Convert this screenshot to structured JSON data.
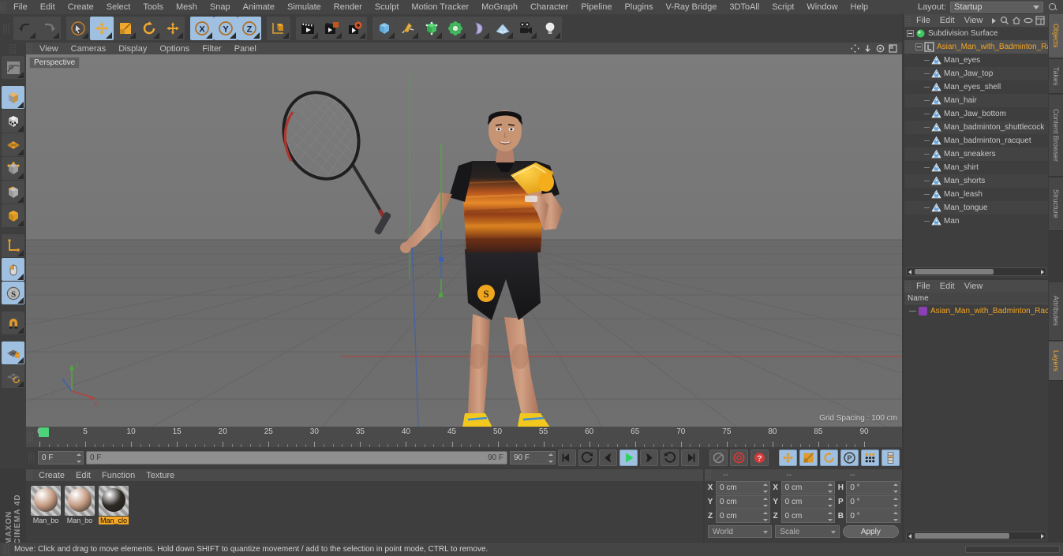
{
  "app": {
    "brand": "MAXON CINEMA 4D"
  },
  "menubar": {
    "items": [
      "File",
      "Edit",
      "Create",
      "Select",
      "Tools",
      "Mesh",
      "Snap",
      "Animate",
      "Simulate",
      "Render",
      "Sculpt",
      "Motion Tracker",
      "MoGraph",
      "Character",
      "Pipeline",
      "Plugins",
      "V-Ray Bridge",
      "3DToAll",
      "Script",
      "Window",
      "Help"
    ],
    "layout_label": "Layout:",
    "layout_value": "Startup",
    "search_icon": "search-icon"
  },
  "toolbar": {
    "buttons": [
      {
        "name": "undo-button",
        "icon": "undo-icon",
        "active": false
      },
      {
        "name": "redo-button",
        "icon": "redo-icon",
        "active": false
      },
      {
        "name": "live-selection-button",
        "icon": "cursor-select-icon",
        "active": false
      },
      {
        "name": "move-tool-button",
        "icon": "move-arrows-icon",
        "active": true
      },
      {
        "name": "scale-tool-button",
        "icon": "scale-box-icon",
        "active": false
      },
      {
        "name": "rotate-tool-button",
        "icon": "rotate-circle-icon",
        "active": false
      },
      {
        "name": "move-axis-button",
        "icon": "move-plus-icon",
        "active": false
      },
      {
        "name": "lock-x-axis-button",
        "icon": "axis-x-icon",
        "active": true
      },
      {
        "name": "lock-y-axis-button",
        "icon": "axis-y-icon",
        "active": true
      },
      {
        "name": "lock-z-axis-button",
        "icon": "axis-z-icon",
        "active": true
      },
      {
        "name": "world-coordinate-button",
        "icon": "world-axis-cube-icon",
        "active": false
      },
      {
        "name": "render-view-button",
        "icon": "render-clapper-icon",
        "active": false
      },
      {
        "name": "render-region-button",
        "icon": "render-clapper-region-icon",
        "active": false
      },
      {
        "name": "render-settings-button",
        "icon": "render-gear-icon",
        "active": false
      },
      {
        "name": "primitive-cube-button",
        "icon": "cube-icon",
        "active": false
      },
      {
        "name": "spline-pen-button",
        "icon": "pen-spline-icon",
        "active": false
      },
      {
        "name": "generator-button",
        "icon": "green-cube-icon",
        "active": false
      },
      {
        "name": "mograph-button",
        "icon": "green-cloner-icon",
        "active": false
      },
      {
        "name": "deformer-button",
        "icon": "bend-deformer-icon",
        "active": false
      },
      {
        "name": "environment-button",
        "icon": "floor-grid-icon",
        "active": false
      },
      {
        "name": "camera-button",
        "icon": "camera-icon",
        "active": false
      },
      {
        "name": "light-button",
        "icon": "light-bulb-icon",
        "active": false
      }
    ]
  },
  "leftbar": {
    "buttons": [
      {
        "name": "make-editable-button",
        "icon": "make-editable-icon",
        "active": false
      },
      {
        "name": "model-mode-button",
        "icon": "model-cube-icon",
        "active": true
      },
      {
        "name": "texture-mode-button",
        "icon": "texture-cube-icon",
        "active": false
      },
      {
        "name": "polygon-mode-button",
        "icon": "polygon-grid-icon",
        "active": false
      },
      {
        "name": "point-mode-button",
        "icon": "point-cube-icon",
        "active": false
      },
      {
        "name": "edge-mode-button",
        "icon": "edge-cube-icon",
        "active": false
      },
      {
        "name": "object-axis-button",
        "icon": "orange-cube-icon",
        "active": false
      },
      {
        "name": "axis-modification-button",
        "icon": "axis-l-icon",
        "active": false
      },
      {
        "name": "viewport-solo-button",
        "icon": "mouse-icon",
        "active": true
      },
      {
        "name": "enable-axis-button",
        "icon": "s-circle-icon",
        "active": true
      },
      {
        "name": "magnet-button",
        "icon": "magnet-icon",
        "active": false
      },
      {
        "name": "lock-workplane-button",
        "icon": "grid-lock-icon",
        "active": true
      },
      {
        "name": "workplane-button",
        "icon": "grid-rotate-icon",
        "active": false
      }
    ]
  },
  "viewport": {
    "menu": [
      "View",
      "Cameras",
      "Display",
      "Options",
      "Filter",
      "Panel"
    ],
    "nav_icons": [
      "pan-icon",
      "zoom-icon",
      "rotate-view-icon",
      "maximize-view-icon"
    ],
    "label": "Perspective",
    "grid_spacing": "Grid Spacing : 100 cm",
    "axis_gizmo": {
      "x_label": "X",
      "y_label": "Y",
      "z_label": "Z"
    }
  },
  "timeline": {
    "ticks": [
      0,
      5,
      10,
      15,
      20,
      25,
      30,
      35,
      40,
      45,
      50,
      55,
      60,
      65,
      70,
      75,
      80,
      85,
      90
    ],
    "current_frame": 0,
    "playhead_frame": 0,
    "frame_field": "0 F",
    "range_start": "0 F",
    "range_end": "90 F",
    "preview_end": "90 F",
    "end_field": "90 F",
    "transport": [
      {
        "name": "go-to-start-button",
        "icon": "skip-start-icon"
      },
      {
        "name": "previous-key-button",
        "icon": "prev-key-icon"
      },
      {
        "name": "step-back-button",
        "icon": "step-back-icon"
      },
      {
        "name": "play-button",
        "icon": "play-icon",
        "active": true
      },
      {
        "name": "step-forward-button",
        "icon": "step-forward-icon"
      },
      {
        "name": "next-key-button",
        "icon": "next-key-icon"
      },
      {
        "name": "go-to-end-button",
        "icon": "skip-end-icon"
      },
      {
        "name": "record-active-objects-button",
        "icon": "record-dot-icon"
      },
      {
        "name": "autokeying-button",
        "icon": "autokey-circle-icon"
      },
      {
        "name": "keyframe-selection-button",
        "icon": "key-question-icon"
      },
      {
        "name": "position-key-button",
        "icon": "position-key-icon",
        "active": true
      },
      {
        "name": "scale-key-button",
        "icon": "scale-key-icon",
        "active": true
      },
      {
        "name": "rotation-key-button",
        "icon": "rotation-key-icon",
        "active": true
      },
      {
        "name": "parameter-key-button",
        "icon": "parameter-key-icon",
        "active": true
      },
      {
        "name": "point-level-animation-button",
        "icon": "pla-dots-icon",
        "active": true
      },
      {
        "name": "key-interpolation-button",
        "icon": "key-interpolation-icon",
        "active": true
      }
    ]
  },
  "materials": {
    "menu": [
      "Create",
      "Edit",
      "Function",
      "Texture"
    ],
    "items": [
      {
        "name": "Man_bo",
        "selected": false,
        "color": "#c59b82"
      },
      {
        "name": "Man_bo",
        "selected": false,
        "color": "#c59b82"
      },
      {
        "name": "Man_clo",
        "selected": true,
        "color": "#2e2a25"
      }
    ]
  },
  "coordinates": {
    "headers": [
      "--",
      "--",
      "--"
    ],
    "rows": [
      {
        "axis": "X",
        "position": "0 cm",
        "axis2": "X",
        "size": "0 cm",
        "axis3": "H",
        "rotation": "0 °"
      },
      {
        "axis": "Y",
        "position": "0 cm",
        "axis2": "Y",
        "size": "0 cm",
        "axis3": "P",
        "rotation": "0 °"
      },
      {
        "axis": "Z",
        "position": "0 cm",
        "axis2": "Z",
        "size": "0 cm",
        "axis3": "B",
        "rotation": "0 °"
      }
    ],
    "system": "World",
    "mode": "Scale",
    "apply_label": "Apply"
  },
  "object_manager": {
    "menu": [
      "File",
      "Edit",
      "View"
    ],
    "tools": [
      "arrow-right-icon",
      "search-icon",
      "home-icon",
      "eye-icon",
      "layout-icon"
    ],
    "items": [
      {
        "label": "Subdivision Surface",
        "depth": 0,
        "icon": "subdivision-surface-icon",
        "selected": false,
        "highlight": false
      },
      {
        "label": "Asian_Man_with_Badminton_Rac",
        "depth": 1,
        "icon": "layer-object-icon",
        "selected": true,
        "highlight": true
      },
      {
        "label": "Man_eyes",
        "depth": 2,
        "icon": "polygon-object-icon",
        "selected": false,
        "highlight": false
      },
      {
        "label": "Man_Jaw_top",
        "depth": 2,
        "icon": "polygon-object-icon",
        "selected": false,
        "highlight": false
      },
      {
        "label": "Man_eyes_shell",
        "depth": 2,
        "icon": "polygon-object-icon",
        "selected": false,
        "highlight": false
      },
      {
        "label": "Man_hair",
        "depth": 2,
        "icon": "polygon-object-icon",
        "selected": false,
        "highlight": false
      },
      {
        "label": "Man_Jaw_bottom",
        "depth": 2,
        "icon": "polygon-object-icon",
        "selected": false,
        "highlight": false
      },
      {
        "label": "Man_badminton_shuttlecock",
        "depth": 2,
        "icon": "polygon-object-icon",
        "selected": false,
        "highlight": false
      },
      {
        "label": "Man_badminton_racquet",
        "depth": 2,
        "icon": "polygon-object-icon",
        "selected": false,
        "highlight": false
      },
      {
        "label": "Man_sneakers",
        "depth": 2,
        "icon": "polygon-object-icon",
        "selected": false,
        "highlight": false
      },
      {
        "label": "Man_shirt",
        "depth": 2,
        "icon": "polygon-object-icon",
        "selected": false,
        "highlight": false
      },
      {
        "label": "Man_shorts",
        "depth": 2,
        "icon": "polygon-object-icon",
        "selected": false,
        "highlight": false
      },
      {
        "label": "Man_leash",
        "depth": 2,
        "icon": "polygon-object-icon",
        "selected": false,
        "highlight": false
      },
      {
        "label": "Man_tongue",
        "depth": 2,
        "icon": "polygon-object-icon",
        "selected": false,
        "highlight": false
      },
      {
        "label": "Man",
        "depth": 2,
        "icon": "polygon-object-icon",
        "selected": false,
        "highlight": false
      }
    ]
  },
  "layer_manager": {
    "menu": [
      "File",
      "Edit",
      "View"
    ],
    "column_header": "Name",
    "items": [
      {
        "label": "Asian_Man_with_Badminton_Rack",
        "color": "#8b3fb5"
      }
    ]
  },
  "vertical_tabs": {
    "top": [
      {
        "label": "Objects",
        "active": true
      },
      {
        "label": "Takes",
        "active": false
      },
      {
        "label": "Content Browser",
        "active": false
      },
      {
        "label": "Structure",
        "active": false
      }
    ],
    "bottom": [
      {
        "label": "Attributes",
        "active": false
      },
      {
        "label": "Layers",
        "active": true
      }
    ]
  },
  "statusbar": {
    "text": "Move: Click and drag to move elements. Hold down SHIFT to quantize movement / add to the selection in point mode, CTRL to remove."
  }
}
